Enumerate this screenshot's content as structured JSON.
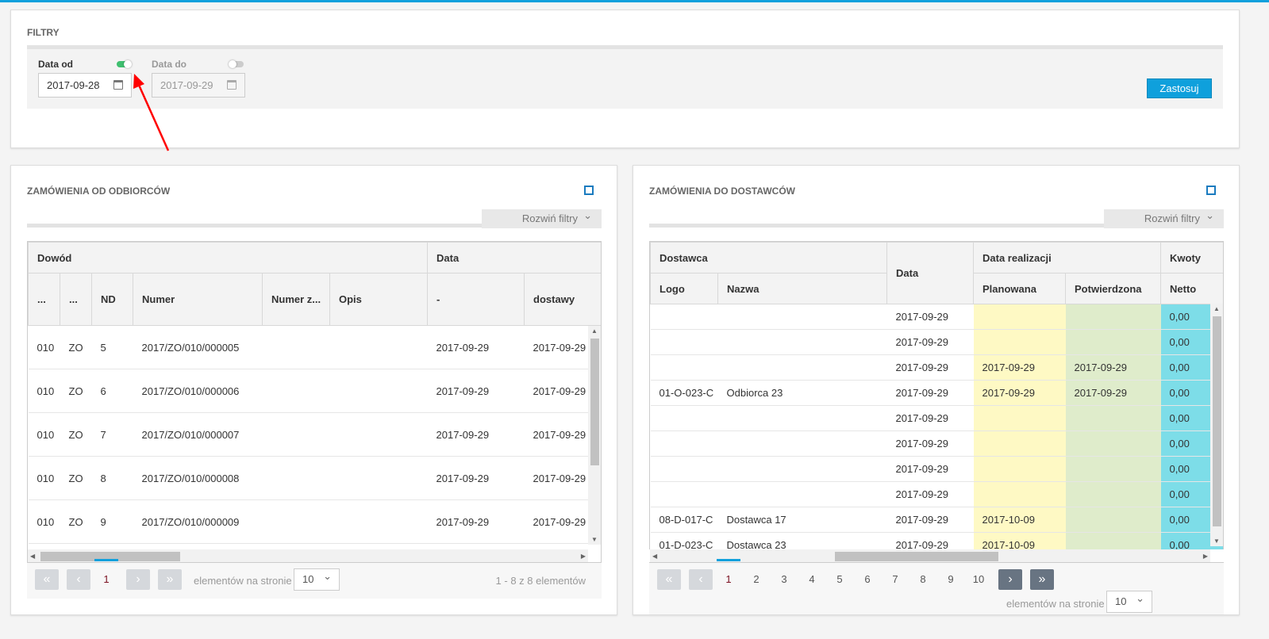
{
  "filters": {
    "title": "FILTRY",
    "date_from": {
      "label": "Data od",
      "value": "2017-09-28",
      "enabled": true
    },
    "date_to": {
      "label": "Data do",
      "value": "2017-09-29",
      "enabled": false
    },
    "apply_label": "Zastosuj"
  },
  "left": {
    "title": "ZAMÓWIENIA OD ODBIORCÓW",
    "expand_filters": "Rozwiń filtry",
    "group_headers": [
      "Dowód",
      "Data"
    ],
    "columns": [
      "...",
      "...",
      "ND",
      "Numer",
      "Numer z...",
      "Opis",
      "-",
      "dostawy"
    ],
    "rows": [
      [
        "010",
        "ZO",
        "5",
        "2017/ZO/010/000005",
        "",
        "",
        "2017-09-29",
        "2017-09-29"
      ],
      [
        "010",
        "ZO",
        "6",
        "2017/ZO/010/000006",
        "",
        "",
        "2017-09-29",
        "2017-09-29"
      ],
      [
        "010",
        "ZO",
        "7",
        "2017/ZO/010/000007",
        "",
        "",
        "2017-09-29",
        "2017-09-29"
      ],
      [
        "010",
        "ZO",
        "8",
        "2017/ZO/010/000008",
        "",
        "",
        "2017-09-29",
        "2017-09-29"
      ],
      [
        "010",
        "ZO",
        "9",
        "2017/ZO/010/000009",
        "",
        "",
        "2017-09-29",
        "2017-09-29"
      ]
    ],
    "pager": {
      "first": "«",
      "prev": "‹",
      "pages": [
        "1"
      ],
      "next": "›",
      "last": "»",
      "per_page_label": "elementów na stronie",
      "per_page": "10",
      "summary": "1 - 8 z 8 elementów"
    }
  },
  "right": {
    "title": "ZAMÓWIENIA DO DOSTAWCÓW",
    "expand_filters": "Rozwiń filtry",
    "group_headers": [
      "Dostawca",
      "Data",
      "Data realizacji",
      "Kwoty"
    ],
    "columns": [
      "Logo",
      "Nazwa",
      "Planowana",
      "Potwierdzona",
      "Netto"
    ],
    "rows": [
      [
        "",
        "",
        "2017-09-29",
        "",
        "",
        "0,00"
      ],
      [
        "",
        "",
        "2017-09-29",
        "",
        "",
        "0,00"
      ],
      [
        "",
        "",
        "2017-09-29",
        "2017-09-29",
        "2017-09-29",
        "0,00"
      ],
      [
        "01-O-023-C",
        "Odbiorca 23",
        "2017-09-29",
        "2017-09-29",
        "2017-09-29",
        "0,00"
      ],
      [
        "",
        "",
        "2017-09-29",
        "",
        "",
        "0,00"
      ],
      [
        "",
        "",
        "2017-09-29",
        "",
        "",
        "0,00"
      ],
      [
        "",
        "",
        "2017-09-29",
        "",
        "",
        "0,00"
      ],
      [
        "",
        "",
        "2017-09-29",
        "",
        "",
        "0,00"
      ],
      [
        "08-D-017-C",
        "Dostawca 17",
        "2017-09-29",
        "2017-10-09",
        "",
        "0,00"
      ],
      [
        "01-D-023-C",
        "Dostawca 23",
        "2017-09-29",
        "2017-10-09",
        "",
        "0,00"
      ]
    ],
    "pager": {
      "first": "«",
      "prev": "‹",
      "pages": [
        "1",
        "2",
        "3",
        "4",
        "5",
        "6",
        "7",
        "8",
        "9",
        "10"
      ],
      "next": "›",
      "last": "»",
      "per_page_label": "elementów na stronie",
      "per_page": "10"
    }
  },
  "colors": {
    "accent": "#0fa0dc",
    "planned": "#fef9c4",
    "confirmed": "#dfeccb",
    "amount": "#7ddde8"
  }
}
